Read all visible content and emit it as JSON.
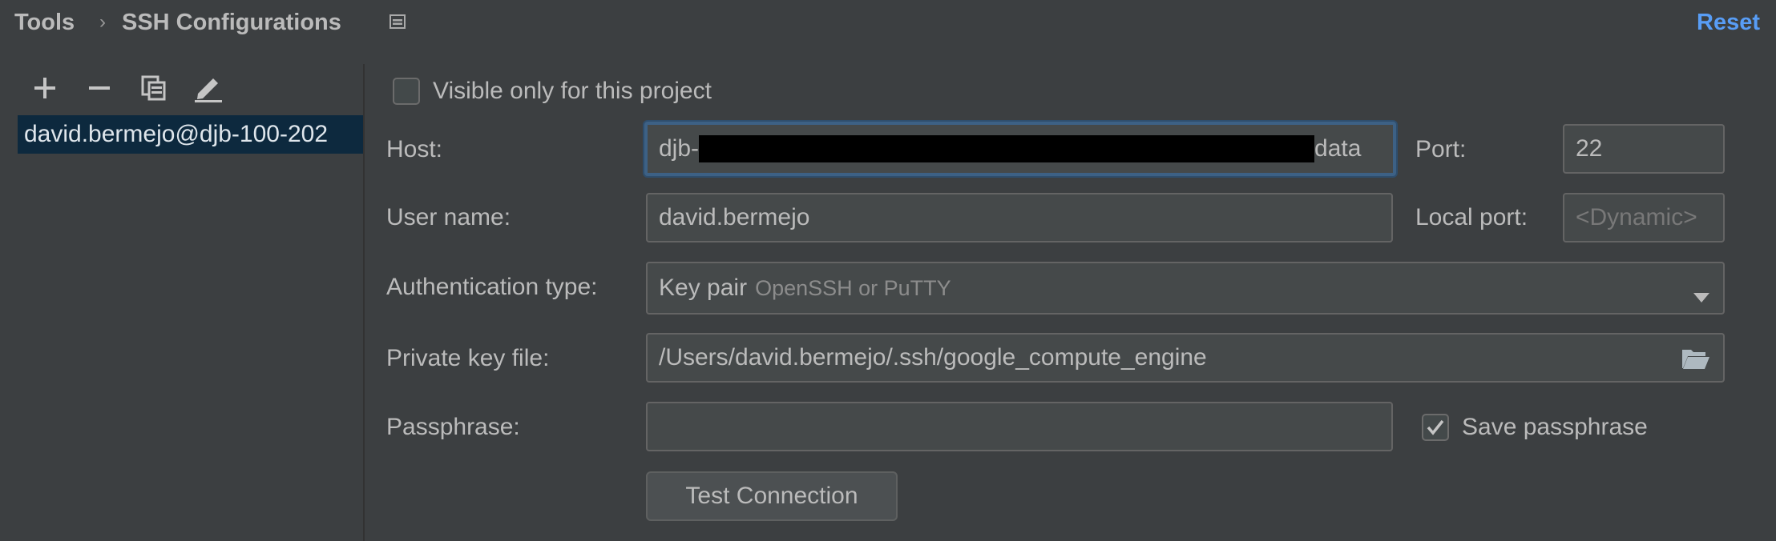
{
  "header": {
    "breadcrumb": [
      "Tools",
      "SSH Configurations"
    ],
    "reset_label": "Reset"
  },
  "sidebar": {
    "configs": [
      "david.bermejo@djb-100-202"
    ]
  },
  "form": {
    "visible_only_label": "Visible only for this project",
    "visible_only_checked": false,
    "host_label": "Host:",
    "host_value_start": "djb-",
    "host_value_end": "data",
    "port_label": "Port:",
    "port_value": "22",
    "username_label": "User name:",
    "username_value": "david.bermejo",
    "localport_label": "Local port:",
    "localport_placeholder": "<Dynamic>",
    "auth_label": "Authentication type:",
    "auth_value": "Key pair",
    "auth_hint": "OpenSSH or PuTTY",
    "keyfile_label": "Private key file:",
    "keyfile_value": "/Users/david.bermejo/.ssh/google_compute_engine",
    "passphrase_label": "Passphrase:",
    "passphrase_value": "",
    "save_passphrase_label": "Save passphrase",
    "save_passphrase_checked": true,
    "test_connection_label": "Test Connection"
  },
  "colors": {
    "background": "#3c3f41",
    "accent": "#589df6",
    "selection": "#0d293e",
    "focus_border": "#3d6185"
  }
}
